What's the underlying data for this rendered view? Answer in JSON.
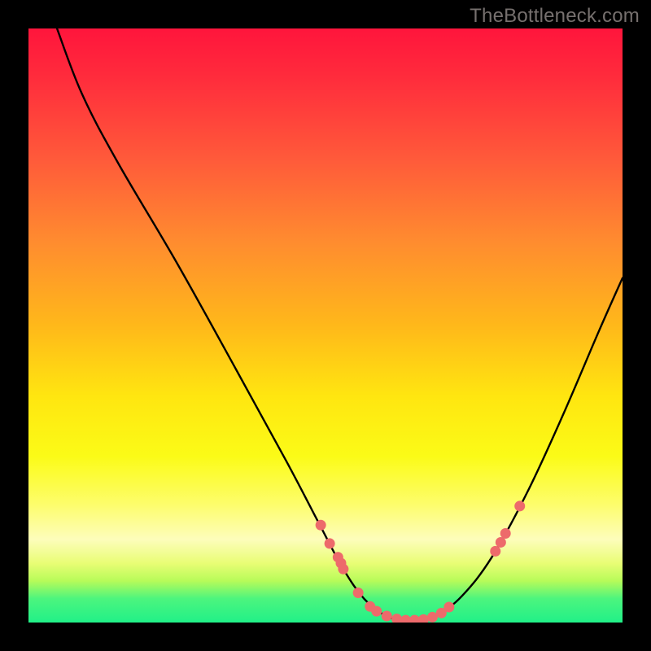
{
  "attribution": "TheBottleneck.com",
  "chart_data": {
    "type": "line",
    "title": "",
    "xlabel": "",
    "ylabel": "",
    "xlim": [
      0,
      100
    ],
    "ylim": [
      0,
      100
    ],
    "curve": [
      {
        "x": 4.8,
        "y": 100.0
      },
      {
        "x": 9.0,
        "y": 89.0
      },
      {
        "x": 15.0,
        "y": 77.5
      },
      {
        "x": 25.0,
        "y": 60.5
      },
      {
        "x": 35.0,
        "y": 42.5
      },
      {
        "x": 43.5,
        "y": 27.0
      },
      {
        "x": 49.0,
        "y": 16.5
      },
      {
        "x": 53.0,
        "y": 9.0
      },
      {
        "x": 56.5,
        "y": 4.0
      },
      {
        "x": 60.0,
        "y": 1.2
      },
      {
        "x": 63.0,
        "y": 0.4
      },
      {
        "x": 66.0,
        "y": 0.4
      },
      {
        "x": 69.0,
        "y": 1.4
      },
      {
        "x": 73.0,
        "y": 4.5
      },
      {
        "x": 78.0,
        "y": 11.0
      },
      {
        "x": 84.0,
        "y": 22.0
      },
      {
        "x": 90.0,
        "y": 35.0
      },
      {
        "x": 96.0,
        "y": 49.0
      },
      {
        "x": 100.0,
        "y": 58.0
      }
    ],
    "markers": [
      {
        "x": 49.2,
        "y": 16.4
      },
      {
        "x": 50.7,
        "y": 13.3
      },
      {
        "x": 52.1,
        "y": 11.0
      },
      {
        "x": 52.6,
        "y": 10.0
      },
      {
        "x": 53.0,
        "y": 9.0
      },
      {
        "x": 55.5,
        "y": 5.0
      },
      {
        "x": 57.5,
        "y": 2.7
      },
      {
        "x": 58.6,
        "y": 1.9
      },
      {
        "x": 60.3,
        "y": 1.1
      },
      {
        "x": 62.0,
        "y": 0.6
      },
      {
        "x": 63.5,
        "y": 0.4
      },
      {
        "x": 65.0,
        "y": 0.4
      },
      {
        "x": 66.5,
        "y": 0.5
      },
      {
        "x": 68.0,
        "y": 0.9
      },
      {
        "x": 69.5,
        "y": 1.6
      },
      {
        "x": 70.8,
        "y": 2.6
      },
      {
        "x": 78.6,
        "y": 12.0
      },
      {
        "x": 79.5,
        "y": 13.5
      },
      {
        "x": 80.3,
        "y": 15.0
      },
      {
        "x": 82.7,
        "y": 19.6
      }
    ],
    "marker_color": "#ed6a6b",
    "marker_radius": 6.5
  }
}
